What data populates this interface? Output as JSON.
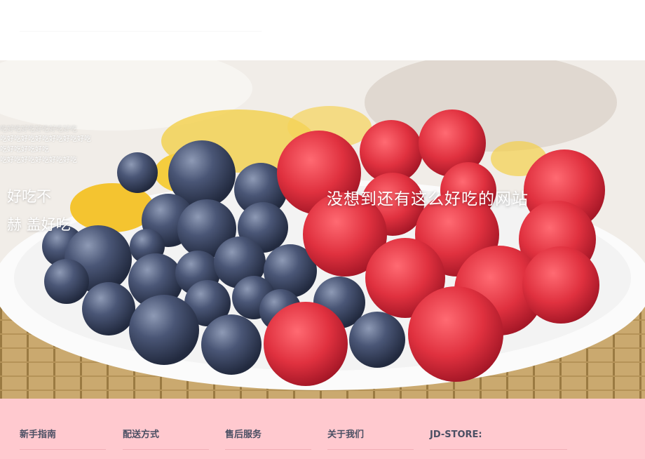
{
  "hero": {
    "ticker_lines": [
      "吃好吃好吃好吃好吃好吃",
      "吃好吃好吃好吃好吃好吃好吃",
      "吃好吃好吃好吃",
      "吃好吃好吃好吃好吃好吃"
    ],
    "side_line_1": "好吃不",
    "side_line_2": "赫        盖好吃",
    "tagline": "没想到还有这么好吃的网站"
  },
  "footer": {
    "columns": [
      {
        "label": "新手指南"
      },
      {
        "label": "配送方式"
      },
      {
        "label": "售后服务"
      },
      {
        "label": "关于我们"
      },
      {
        "label": "JD-STORE:"
      }
    ]
  },
  "colors": {
    "footer_bg": "#ffc9cf",
    "footer_text": "#4a4f63",
    "raspberry": "#e23a48",
    "blueberry": "#3d4a6a"
  }
}
